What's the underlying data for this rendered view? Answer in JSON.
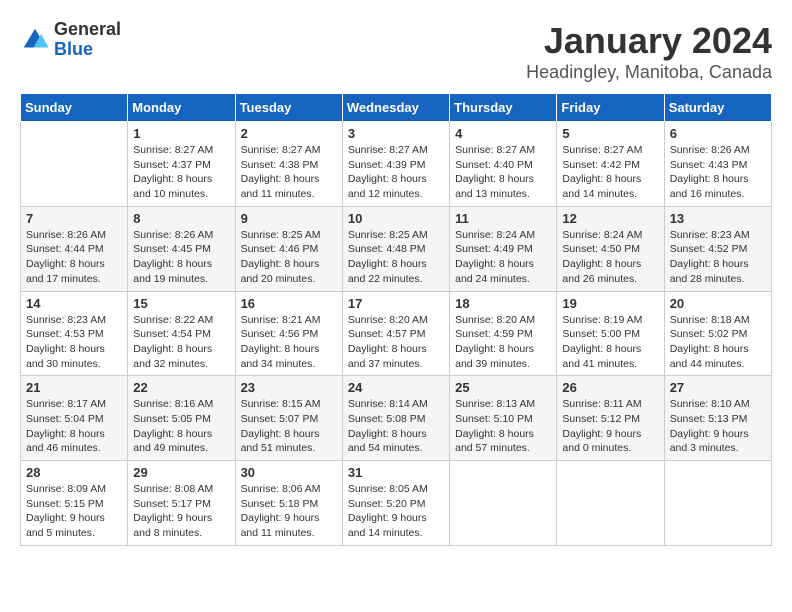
{
  "logo": {
    "general": "General",
    "blue": "Blue"
  },
  "title": "January 2024",
  "subtitle": "Headingley, Manitoba, Canada",
  "days_of_week": [
    "Sunday",
    "Monday",
    "Tuesday",
    "Wednesday",
    "Thursday",
    "Friday",
    "Saturday"
  ],
  "weeks": [
    [
      {
        "day": "",
        "info": ""
      },
      {
        "day": "1",
        "info": "Sunrise: 8:27 AM\nSunset: 4:37 PM\nDaylight: 8 hours\nand 10 minutes."
      },
      {
        "day": "2",
        "info": "Sunrise: 8:27 AM\nSunset: 4:38 PM\nDaylight: 8 hours\nand 11 minutes."
      },
      {
        "day": "3",
        "info": "Sunrise: 8:27 AM\nSunset: 4:39 PM\nDaylight: 8 hours\nand 12 minutes."
      },
      {
        "day": "4",
        "info": "Sunrise: 8:27 AM\nSunset: 4:40 PM\nDaylight: 8 hours\nand 13 minutes."
      },
      {
        "day": "5",
        "info": "Sunrise: 8:27 AM\nSunset: 4:42 PM\nDaylight: 8 hours\nand 14 minutes."
      },
      {
        "day": "6",
        "info": "Sunrise: 8:26 AM\nSunset: 4:43 PM\nDaylight: 8 hours\nand 16 minutes."
      }
    ],
    [
      {
        "day": "7",
        "info": "Sunrise: 8:26 AM\nSunset: 4:44 PM\nDaylight: 8 hours\nand 17 minutes."
      },
      {
        "day": "8",
        "info": "Sunrise: 8:26 AM\nSunset: 4:45 PM\nDaylight: 8 hours\nand 19 minutes."
      },
      {
        "day": "9",
        "info": "Sunrise: 8:25 AM\nSunset: 4:46 PM\nDaylight: 8 hours\nand 20 minutes."
      },
      {
        "day": "10",
        "info": "Sunrise: 8:25 AM\nSunset: 4:48 PM\nDaylight: 8 hours\nand 22 minutes."
      },
      {
        "day": "11",
        "info": "Sunrise: 8:24 AM\nSunset: 4:49 PM\nDaylight: 8 hours\nand 24 minutes."
      },
      {
        "day": "12",
        "info": "Sunrise: 8:24 AM\nSunset: 4:50 PM\nDaylight: 8 hours\nand 26 minutes."
      },
      {
        "day": "13",
        "info": "Sunrise: 8:23 AM\nSunset: 4:52 PM\nDaylight: 8 hours\nand 28 minutes."
      }
    ],
    [
      {
        "day": "14",
        "info": "Sunrise: 8:23 AM\nSunset: 4:53 PM\nDaylight: 8 hours\nand 30 minutes."
      },
      {
        "day": "15",
        "info": "Sunrise: 8:22 AM\nSunset: 4:54 PM\nDaylight: 8 hours\nand 32 minutes."
      },
      {
        "day": "16",
        "info": "Sunrise: 8:21 AM\nSunset: 4:56 PM\nDaylight: 8 hours\nand 34 minutes."
      },
      {
        "day": "17",
        "info": "Sunrise: 8:20 AM\nSunset: 4:57 PM\nDaylight: 8 hours\nand 37 minutes."
      },
      {
        "day": "18",
        "info": "Sunrise: 8:20 AM\nSunset: 4:59 PM\nDaylight: 8 hours\nand 39 minutes."
      },
      {
        "day": "19",
        "info": "Sunrise: 8:19 AM\nSunset: 5:00 PM\nDaylight: 8 hours\nand 41 minutes."
      },
      {
        "day": "20",
        "info": "Sunrise: 8:18 AM\nSunset: 5:02 PM\nDaylight: 8 hours\nand 44 minutes."
      }
    ],
    [
      {
        "day": "21",
        "info": "Sunrise: 8:17 AM\nSunset: 5:04 PM\nDaylight: 8 hours\nand 46 minutes."
      },
      {
        "day": "22",
        "info": "Sunrise: 8:16 AM\nSunset: 5:05 PM\nDaylight: 8 hours\nand 49 minutes."
      },
      {
        "day": "23",
        "info": "Sunrise: 8:15 AM\nSunset: 5:07 PM\nDaylight: 8 hours\nand 51 minutes."
      },
      {
        "day": "24",
        "info": "Sunrise: 8:14 AM\nSunset: 5:08 PM\nDaylight: 8 hours\nand 54 minutes."
      },
      {
        "day": "25",
        "info": "Sunrise: 8:13 AM\nSunset: 5:10 PM\nDaylight: 8 hours\nand 57 minutes."
      },
      {
        "day": "26",
        "info": "Sunrise: 8:11 AM\nSunset: 5:12 PM\nDaylight: 9 hours\nand 0 minutes."
      },
      {
        "day": "27",
        "info": "Sunrise: 8:10 AM\nSunset: 5:13 PM\nDaylight: 9 hours\nand 3 minutes."
      }
    ],
    [
      {
        "day": "28",
        "info": "Sunrise: 8:09 AM\nSunset: 5:15 PM\nDaylight: 9 hours\nand 5 minutes."
      },
      {
        "day": "29",
        "info": "Sunrise: 8:08 AM\nSunset: 5:17 PM\nDaylight: 9 hours\nand 8 minutes."
      },
      {
        "day": "30",
        "info": "Sunrise: 8:06 AM\nSunset: 5:18 PM\nDaylight: 9 hours\nand 11 minutes."
      },
      {
        "day": "31",
        "info": "Sunrise: 8:05 AM\nSunset: 5:20 PM\nDaylight: 9 hours\nand 14 minutes."
      },
      {
        "day": "",
        "info": ""
      },
      {
        "day": "",
        "info": ""
      },
      {
        "day": "",
        "info": ""
      }
    ]
  ]
}
